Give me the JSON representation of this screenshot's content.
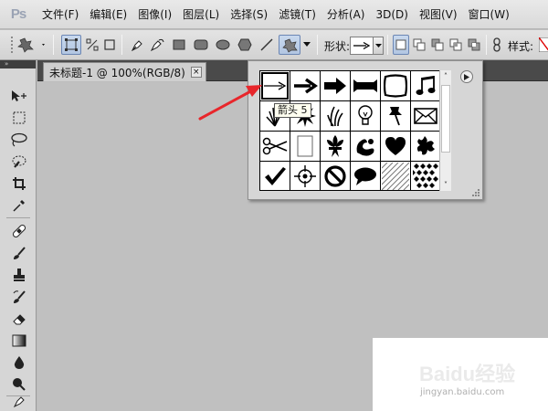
{
  "app": {
    "logo": "Ps"
  },
  "menu": [
    {
      "label": "文件(F)",
      "name": "menu-file"
    },
    {
      "label": "编辑(E)",
      "name": "menu-edit"
    },
    {
      "label": "图像(I)",
      "name": "menu-image"
    },
    {
      "label": "图层(L)",
      "name": "menu-layer"
    },
    {
      "label": "选择(S)",
      "name": "menu-select"
    },
    {
      "label": "滤镜(T)",
      "name": "menu-filter"
    },
    {
      "label": "分析(A)",
      "name": "menu-analysis"
    },
    {
      "label": "3D(D)",
      "name": "menu-3d"
    },
    {
      "label": "视图(V)",
      "name": "menu-view"
    },
    {
      "label": "窗口(W)",
      "name": "menu-window"
    }
  ],
  "options": {
    "shape_label": "形状:",
    "style_label": "样式:",
    "selected_tool_icon": "custom-shape-icon",
    "tool_modes": [
      "shape-layers",
      "paths",
      "fill-pixels"
    ],
    "draw_tools": [
      "pen",
      "freeform-pen",
      "rectangle",
      "rounded-rectangle",
      "ellipse",
      "polygon",
      "line",
      "custom-shape"
    ]
  },
  "document": {
    "tab_title": "未标题-1 @ 100%(RGB/8)",
    "close_glyph": "×"
  },
  "tools_panel": {
    "header": "»",
    "tools": [
      "move",
      "marquee",
      "lasso",
      "quick-select",
      "crop",
      "eyedropper",
      "healing",
      "brush",
      "clone-stamp",
      "history-brush",
      "eraser",
      "gradient",
      "blur",
      "dodge",
      "pen"
    ]
  },
  "shape_picker": {
    "selected": "arrow-thin",
    "tooltip": "箭头 5",
    "shapes": [
      "arrow-thin",
      "arrow-bold",
      "arrow-heavy",
      "banner",
      "frame",
      "music-note",
      "grass",
      "burst",
      "grass-2",
      "lightbulb",
      "pushpin",
      "envelope",
      "scissors",
      "blank-page",
      "fleur-de-lis",
      "ornament",
      "heart",
      "splat",
      "checkmark",
      "crosshair",
      "no-symbol",
      "speech-bubble",
      "diagonal-hatch",
      "checkerboard"
    ],
    "scroll_up": "˄",
    "scroll_down": "˅",
    "menu_icon": "flyout-menu-icon"
  },
  "watermark": {
    "brand": "Baidu经验",
    "url": "jingyan.baidu.com"
  },
  "colors": {
    "annotation_arrow": "#e8262b",
    "menu_bg": "#e3e3e3",
    "canvas_bg": "#c0c0c0"
  }
}
